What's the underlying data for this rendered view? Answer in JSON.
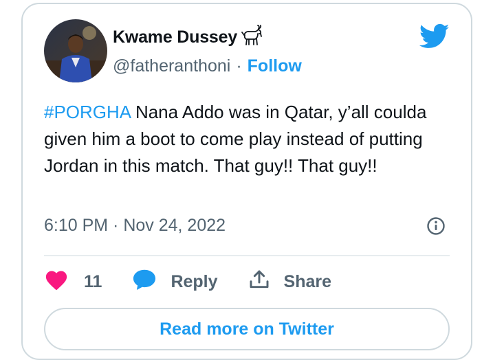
{
  "author": {
    "name": "Kwame Dussey",
    "handle": "@fatheranthoni",
    "separator": "·",
    "follow_label": "Follow",
    "name_emoji_icon": "goat-icon"
  },
  "tweet": {
    "hashtag": "#PORGHA",
    "text": " Nana Addo was in Qatar, y’all coulda given him a boot to come play instead of putting Jordan in this match. That guy!! That guy!!",
    "timestamp": "6:10 PM · Nov 24, 2022"
  },
  "actions": {
    "like_count": "11",
    "reply_label": "Reply",
    "share_label": "Share"
  },
  "read_more_label": "Read more on Twitter",
  "colors": {
    "twitter_blue": "#1d9bf0",
    "like_red": "#f91880",
    "text_primary": "#0f1419",
    "text_secondary": "#536471",
    "border": "#cfd9de"
  }
}
